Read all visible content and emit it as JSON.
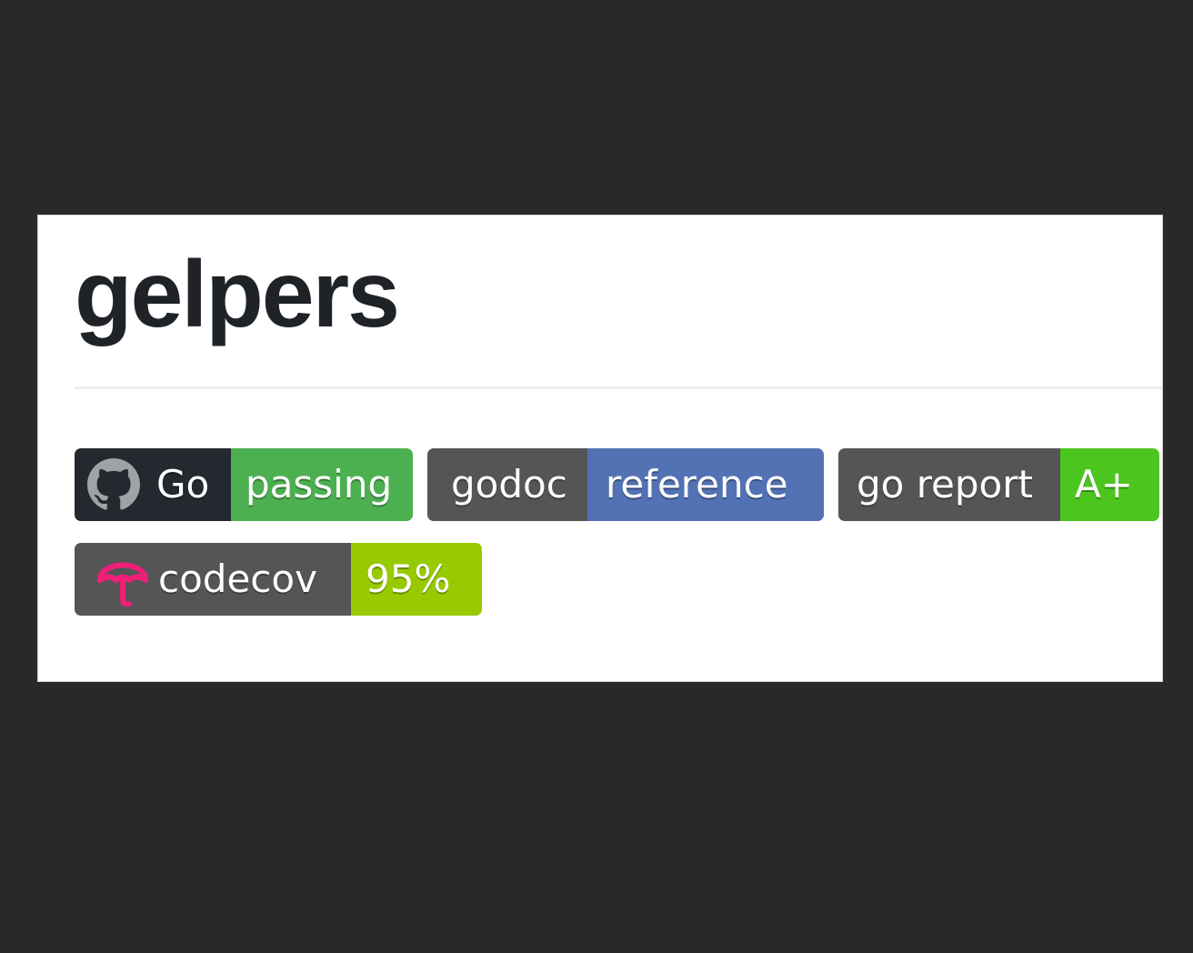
{
  "readme": {
    "title": "gelpers"
  },
  "badges": [
    {
      "label": "Go",
      "message": "passing",
      "icon": "github-icon",
      "label_color": "#24292f",
      "message_color": "#4caf50"
    },
    {
      "label": "godoc",
      "message": "reference",
      "label_color": "#555555",
      "message_color": "#5272b4"
    },
    {
      "label": "go report",
      "message": "A+",
      "label_color": "#555555",
      "message_color": "#4cc61e"
    },
    {
      "label": "codecov",
      "message": "95%",
      "icon": "codecov-umbrella-icon",
      "icon_color": "#f01f7a",
      "label_color": "#555555",
      "message_color": "#97ca00"
    }
  ]
}
